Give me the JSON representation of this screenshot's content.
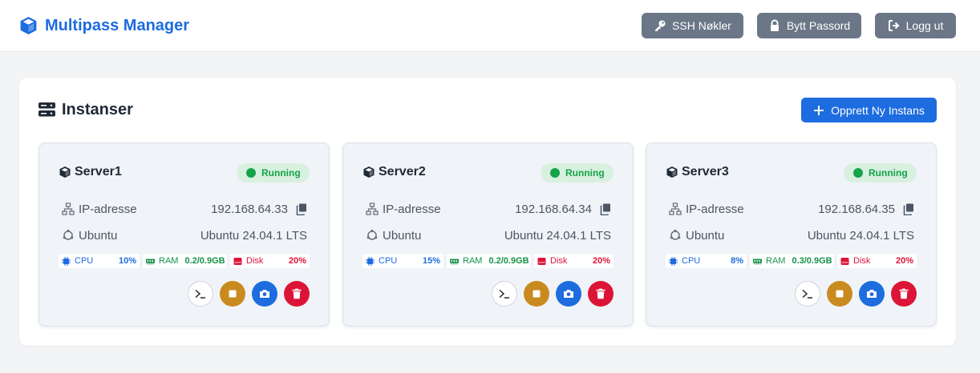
{
  "header": {
    "title": "Multipass Manager",
    "ssh_keys_label": "SSH Nøkler",
    "change_password_label": "Bytt Passord",
    "logout_label": "Logg ut"
  },
  "instances": {
    "title": "Instanser",
    "create_label": "Opprett Ny Instans",
    "ip_label": "IP-adresse",
    "os_label": "Ubuntu",
    "cpu_label": "CPU",
    "ram_label": "RAM",
    "disk_label": "Disk",
    "cards": [
      {
        "name": "Server1",
        "status": "Running",
        "ip": "192.168.64.33",
        "os_version": "Ubuntu 24.04.1 LTS",
        "cpu": "10%",
        "ram": "0.2/0.9GB",
        "disk": "20%"
      },
      {
        "name": "Server2",
        "status": "Running",
        "ip": "192.168.64.34",
        "os_version": "Ubuntu 24.04.1 LTS",
        "cpu": "15%",
        "ram": "0.2/0.9GB",
        "disk": "20%"
      },
      {
        "name": "Server3",
        "status": "Running",
        "ip": "192.168.64.35",
        "os_version": "Ubuntu 24.04.1 LTS",
        "cpu": "8%",
        "ram": "0.3/0.9GB",
        "disk": "20%"
      }
    ]
  },
  "colors": {
    "primary": "#1d6ce0",
    "header_button": "#6b7787",
    "status_running": "#16a34a",
    "stop": "#c98a1f",
    "danger": "#dc1438"
  },
  "icons": {
    "brand": "cube-icon",
    "ssh": "key-icon",
    "password": "lock-icon",
    "logout": "sign-out-icon",
    "instances": "server-icon",
    "create": "plus-icon",
    "ip": "network-icon",
    "os": "ubuntu-icon",
    "copy": "copy-icon",
    "cpu": "microchip-icon",
    "ram": "memory-icon",
    "disk": "hdd-icon",
    "terminal": "terminal-icon",
    "stop": "stop-icon",
    "snapshot": "camera-icon",
    "delete": "trash-icon"
  }
}
